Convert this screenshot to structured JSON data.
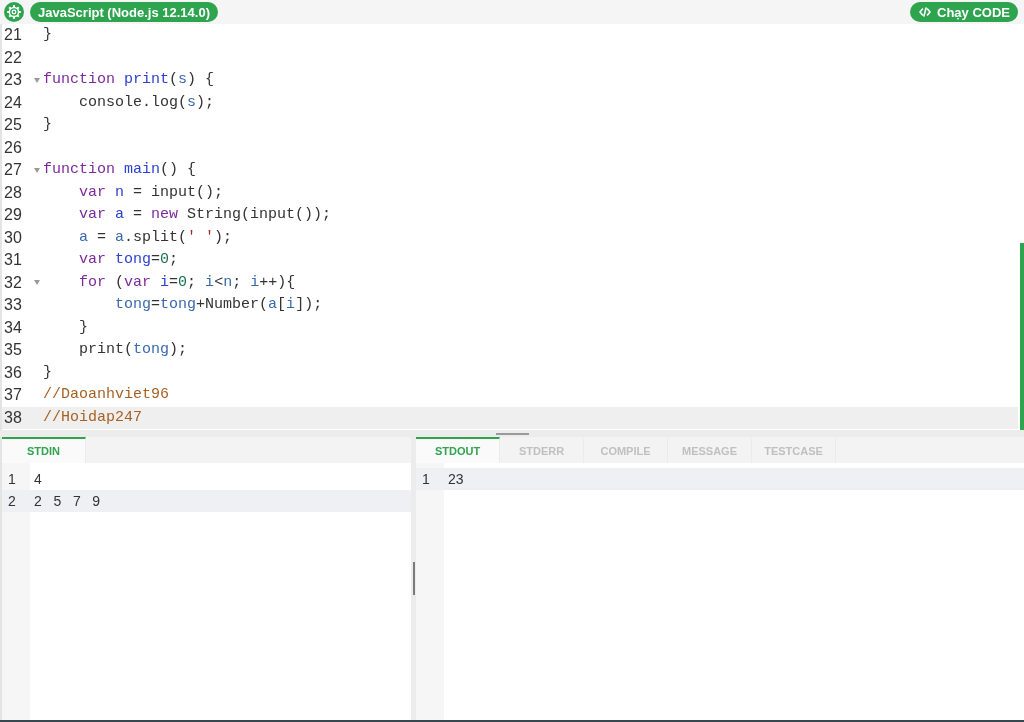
{
  "toolbar": {
    "language": "JavaScript (Node.js 12.14.0)",
    "run_button": "Chạy CODE"
  },
  "editor": {
    "lines": [
      {
        "number": "21",
        "active": false,
        "foldable": false,
        "tokens": [
          {
            "kind": "plain",
            "text": "}"
          }
        ]
      },
      {
        "number": "22",
        "active": false,
        "foldable": false
      },
      {
        "number": "23",
        "active": false,
        "foldable": true,
        "tokens": [
          {
            "kind": "keyword",
            "text": "function "
          },
          {
            "kind": "def",
            "text": "print"
          },
          {
            "kind": "plain",
            "text": "("
          },
          {
            "kind": "variable",
            "text": "s"
          },
          {
            "kind": "plain",
            "text": ") {"
          }
        ]
      },
      {
        "number": "24",
        "active": false,
        "foldable": false,
        "tokens": [
          {
            "kind": "plain",
            "text": "    console.log("
          },
          {
            "kind": "variable",
            "text": "s"
          },
          {
            "kind": "plain",
            "text": ");"
          }
        ]
      },
      {
        "number": "25",
        "active": false,
        "foldable": false,
        "tokens": [
          {
            "kind": "plain",
            "text": "}"
          }
        ]
      },
      {
        "number": "26",
        "active": false,
        "foldable": false
      },
      {
        "number": "27",
        "active": false,
        "foldable": true,
        "tokens": [
          {
            "kind": "keyword",
            "text": "function "
          },
          {
            "kind": "def",
            "text": "main"
          },
          {
            "kind": "plain",
            "text": "() {"
          }
        ]
      },
      {
        "number": "28",
        "active": false,
        "foldable": false,
        "tokens": [
          {
            "kind": "keyword",
            "text": "    var "
          },
          {
            "kind": "def",
            "text": "n"
          },
          {
            "kind": "plain",
            "text": " = input();"
          }
        ]
      },
      {
        "number": "29",
        "active": false,
        "foldable": false,
        "tokens": [
          {
            "kind": "keyword",
            "text": "    var "
          },
          {
            "kind": "def",
            "text": "a"
          },
          {
            "kind": "plain",
            "text": " = "
          },
          {
            "kind": "keyword",
            "text": "new"
          },
          {
            "kind": "plain",
            "text": " String(input());"
          }
        ]
      },
      {
        "number": "30",
        "active": false,
        "foldable": false,
        "tokens": [
          {
            "kind": "variable",
            "text": "    a"
          },
          {
            "kind": "plain",
            "text": " = "
          },
          {
            "kind": "variable",
            "text": "a"
          },
          {
            "kind": "plain",
            "text": ".split("
          },
          {
            "kind": "string",
            "text": "' '"
          },
          {
            "kind": "plain",
            "text": ");"
          }
        ]
      },
      {
        "number": "31",
        "active": false,
        "foldable": false,
        "tokens": [
          {
            "kind": "keyword",
            "text": "    var "
          },
          {
            "kind": "def",
            "text": "tong"
          },
          {
            "kind": "plain",
            "text": "="
          },
          {
            "kind": "number",
            "text": "0"
          },
          {
            "kind": "plain",
            "text": ";"
          }
        ]
      },
      {
        "number": "32",
        "active": false,
        "foldable": true,
        "tokens": [
          {
            "kind": "keyword",
            "text": "    for"
          },
          {
            "kind": "plain",
            "text": " ("
          },
          {
            "kind": "keyword",
            "text": "var "
          },
          {
            "kind": "def",
            "text": "i"
          },
          {
            "kind": "plain",
            "text": "="
          },
          {
            "kind": "number",
            "text": "0"
          },
          {
            "kind": "plain",
            "text": "; "
          },
          {
            "kind": "variable",
            "text": "i"
          },
          {
            "kind": "plain",
            "text": "<"
          },
          {
            "kind": "variable",
            "text": "n"
          },
          {
            "kind": "plain",
            "text": "; "
          },
          {
            "kind": "variable",
            "text": "i"
          },
          {
            "kind": "plain",
            "text": "++){"
          }
        ]
      },
      {
        "number": "33",
        "active": false,
        "foldable": false,
        "tokens": [
          {
            "kind": "variable",
            "text": "        tong"
          },
          {
            "kind": "plain",
            "text": "="
          },
          {
            "kind": "variable",
            "text": "tong"
          },
          {
            "kind": "plain",
            "text": "+Number("
          },
          {
            "kind": "variable",
            "text": "a"
          },
          {
            "kind": "plain",
            "text": "["
          },
          {
            "kind": "variable",
            "text": "i"
          },
          {
            "kind": "plain",
            "text": "]);"
          }
        ]
      },
      {
        "number": "34",
        "active": false,
        "foldable": false,
        "tokens": [
          {
            "kind": "plain",
            "text": "    }"
          }
        ]
      },
      {
        "number": "35",
        "active": false,
        "foldable": false,
        "tokens": [
          {
            "kind": "plain",
            "text": "    print("
          },
          {
            "kind": "variable",
            "text": "tong"
          },
          {
            "kind": "plain",
            "text": ");"
          }
        ]
      },
      {
        "number": "36",
        "active": false,
        "foldable": false,
        "tokens": [
          {
            "kind": "plain",
            "text": "}"
          }
        ]
      },
      {
        "number": "37",
        "active": false,
        "foldable": false,
        "tokens": [
          {
            "kind": "comment",
            "text": "//Daoanhviet96"
          }
        ]
      },
      {
        "number": "38",
        "active": true,
        "foldable": false,
        "tokens": [
          {
            "kind": "comment",
            "text": "//Hoidap247"
          }
        ]
      }
    ]
  },
  "stdin_panel": {
    "tabs": [
      {
        "label": "STDIN",
        "selected": true
      }
    ],
    "lines": [
      {
        "number": "1",
        "text": "4",
        "active": false
      },
      {
        "number": "2",
        "text": "2   5   7   9",
        "active": true
      }
    ]
  },
  "output_panel": {
    "tabs": [
      {
        "label": "STDOUT",
        "selected": true
      },
      {
        "label": "STDERR",
        "selected": false
      },
      {
        "label": "COMPILE",
        "selected": false
      },
      {
        "label": "MESSAGE",
        "selected": false
      },
      {
        "label": "TESTCASE",
        "selected": false
      }
    ],
    "lines": [
      {
        "number": "1",
        "text": "23",
        "active": true
      }
    ]
  }
}
